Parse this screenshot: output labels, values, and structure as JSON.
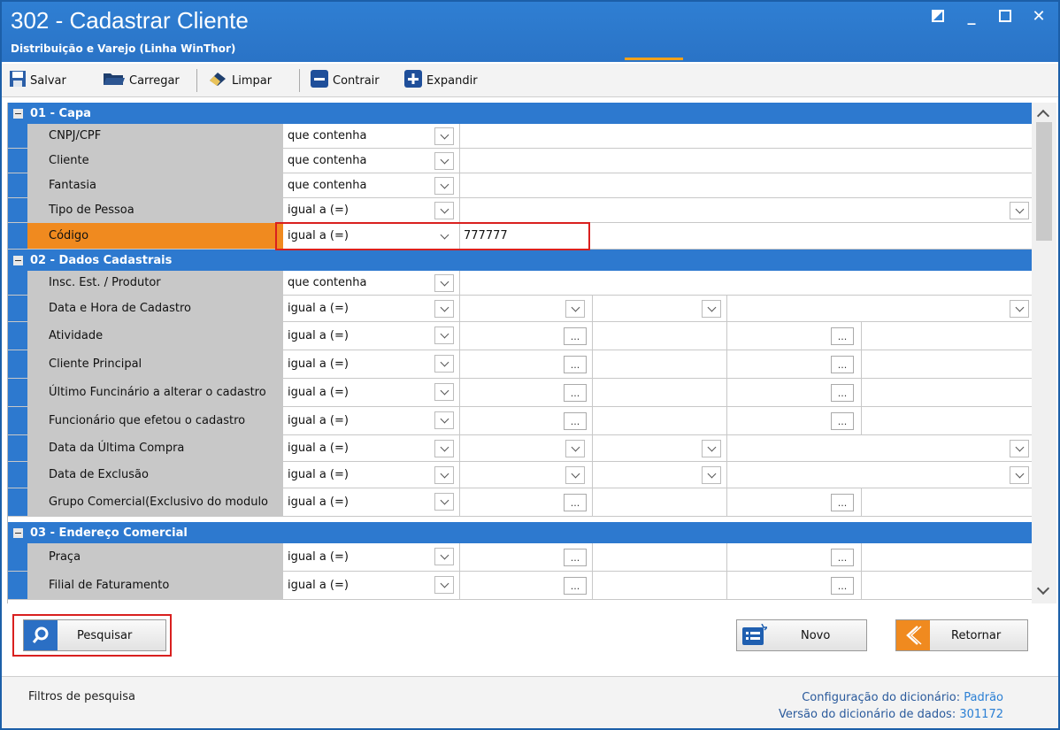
{
  "window": {
    "title": "302 - Cadastrar Cliente",
    "subtitle": "Distribuição e Varejo (Linha WinThor)"
  },
  "toolbar": {
    "save_label": "Salvar",
    "load_label": "Carregar",
    "clear_label": "Limpar",
    "collapse_label": "Contrair",
    "expand_label": "Expandir"
  },
  "sections": {
    "capa": {
      "title": "01 - Capa",
      "rows": [
        {
          "label": "CNPJ/CPF",
          "operator": "que contenha",
          "value": ""
        },
        {
          "label": "Cliente",
          "operator": "que contenha",
          "value": ""
        },
        {
          "label": "Fantasia",
          "operator": "que contenha",
          "value": ""
        },
        {
          "label": "Tipo de Pessoa",
          "operator": "igual a (=)",
          "value": ""
        },
        {
          "label": "Código",
          "operator": "igual a (=)",
          "value": "777777"
        }
      ]
    },
    "dados": {
      "title": "02 - Dados Cadastrais",
      "rows": [
        {
          "label": "Insc. Est. / Produtor",
          "operator": "que contenha"
        },
        {
          "label": "Data e Hora de Cadastro",
          "operator": "igual a (=)"
        },
        {
          "label": "Atividade",
          "operator": "igual a (=)"
        },
        {
          "label": "Cliente Principal",
          "operator": "igual a (=)"
        },
        {
          "label": "Último Funcinário a alterar o cadastro",
          "operator": "igual a (=)"
        },
        {
          "label": "Funcionário que efetou o cadastro",
          "operator": "igual a (=)"
        },
        {
          "label": "Data da Última Compra",
          "operator": "igual a (=)"
        },
        {
          "label": "Data de Exclusão",
          "operator": "igual a (=)"
        },
        {
          "label": "Grupo Comercial(Exclusivo do modulo",
          "operator": "igual a (=)"
        }
      ]
    },
    "endereco": {
      "title": "03 - Endereço Comercial",
      "rows": [
        {
          "label": "Praça",
          "operator": "igual a (=)"
        },
        {
          "label": "Filial de Faturamento",
          "operator": "igual a (=)"
        }
      ]
    }
  },
  "ellipsis": "...",
  "buttons": {
    "search": "Pesquisar",
    "new": "Novo",
    "back": "Retornar"
  },
  "status": {
    "left": "Filtros de pesquisa",
    "dict_config_label": "Configuração do dicionário:",
    "dict_config_value": "Padrão",
    "dict_version_label": "Versão do dicionário de dados:",
    "dict_version_value": "301172"
  },
  "colors": {
    "title_bar": "#2f7fd3",
    "section_header": "#2d79cf",
    "highlight_row": "#f08a1f",
    "annotation_box": "#d9201f"
  }
}
